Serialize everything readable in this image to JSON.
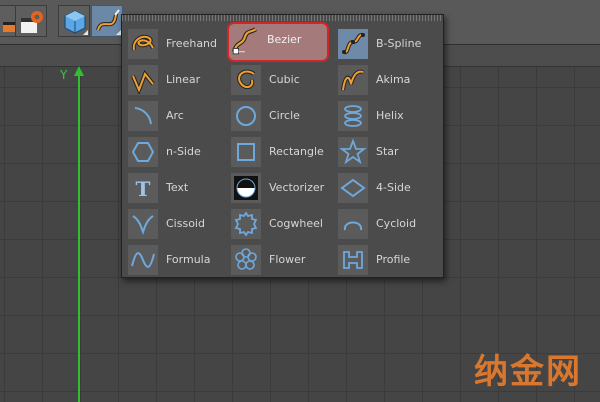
{
  "menu": {
    "items": [
      {
        "label": "Freehand",
        "icon": "freehand-icon"
      },
      {
        "label": "Bezier",
        "icon": "bezier-icon"
      },
      {
        "label": "B-Spline",
        "icon": "bspline-icon"
      },
      {
        "label": "Linear",
        "icon": "linear-icon"
      },
      {
        "label": "Cubic",
        "icon": "cubic-icon"
      },
      {
        "label": "Akima",
        "icon": "akima-icon"
      },
      {
        "label": "Arc",
        "icon": "arc-icon"
      },
      {
        "label": "Circle",
        "icon": "circle-icon"
      },
      {
        "label": "Helix",
        "icon": "helix-icon"
      },
      {
        "label": "n-Side",
        "icon": "n-side-icon"
      },
      {
        "label": "Rectangle",
        "icon": "rectangle-icon"
      },
      {
        "label": "Star",
        "icon": "star-icon"
      },
      {
        "label": "Text",
        "icon": "text-icon"
      },
      {
        "label": "Vectorizer",
        "icon": "vectorizer-icon"
      },
      {
        "label": "4-Side",
        "icon": "four-side-icon"
      },
      {
        "label": "Cissoid",
        "icon": "cissoid-icon"
      },
      {
        "label": "Cogwheel",
        "icon": "cogwheel-icon"
      },
      {
        "label": "Cycloid",
        "icon": "cycloid-icon"
      },
      {
        "label": "Formula",
        "icon": "formula-icon"
      },
      {
        "label": "Flower",
        "icon": "flower-icon"
      },
      {
        "label": "Profile",
        "icon": "profile-icon"
      }
    ],
    "selected": "Bezier"
  },
  "viewport": {
    "axis_label": "Y"
  },
  "watermark": {
    "text": "纳金网"
  },
  "colors": {
    "accent_blue": "#6ea8dc",
    "spline_orange": "#e8942a",
    "selection_red": "#d22626",
    "axis_green": "#2fbf2f"
  }
}
